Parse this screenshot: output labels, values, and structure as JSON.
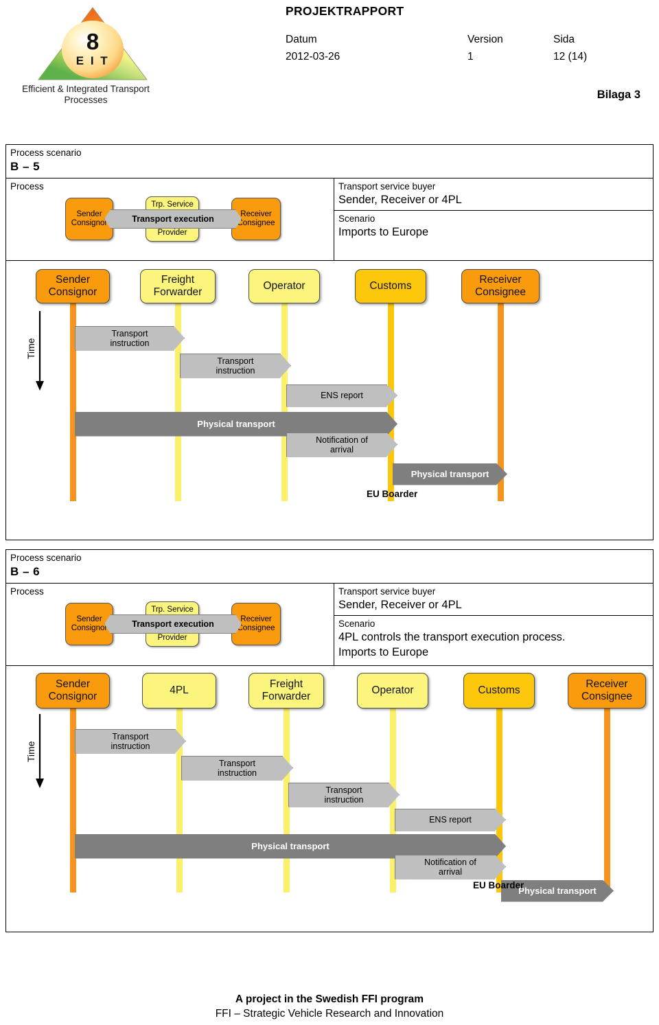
{
  "header": {
    "logo": {
      "number": "8",
      "acronym": "E I T",
      "caption": "Efficient & Integrated Transport Processes"
    },
    "title": "PROJEKTRAPPORT",
    "labels": {
      "datum": "Datum",
      "version": "Version",
      "sida": "Sida"
    },
    "values": {
      "datum": "2012-03-26",
      "version": "1",
      "sida": "12 (14)"
    },
    "appendix": "Bilaga 3"
  },
  "scenarios": [
    {
      "scenario_label": "Process scenario",
      "scenario_id": "B – 5",
      "process_label": "Process",
      "mini": {
        "sender": "Sender\nConsignor",
        "receiver": "Receiver\nConsignee",
        "provider_top": "Trp. Service",
        "provider_bottom": "Provider",
        "arrow": "Transport execution"
      },
      "buyer_label": "Transport service buyer",
      "buyer_value": "Sender, Receiver or 4PL",
      "scenario_desc_label": "Scenario",
      "scenario_desc_value": "Imports to Europe",
      "time_label": "Time",
      "eu_boarder": "EU Boarder",
      "lanes": [
        {
          "label": "Sender\nConsignor",
          "color": "c-orange",
          "line": "ll-orange"
        },
        {
          "label": "Freight\nForwarder",
          "color": "c-yellow",
          "line": "ll-yellow"
        },
        {
          "label": "Operator",
          "color": "c-yellow",
          "line": "ll-yellow"
        },
        {
          "label": "Customs",
          "color": "c-amber",
          "line": "ll-amber"
        },
        {
          "label": "Receiver\nConsignee",
          "color": "c-orange",
          "line": "ll-orange"
        }
      ],
      "messages": [
        {
          "text": "Transport\ninstruction",
          "from": 0,
          "to": 1,
          "style": "light"
        },
        {
          "text": "Transport\ninstruction",
          "from": 1,
          "to": 2,
          "style": "light"
        },
        {
          "text": "ENS report",
          "from": 2,
          "to": 3,
          "style": "light"
        },
        {
          "text": "Physical transport",
          "from": 0,
          "to": 3,
          "style": "dark"
        },
        {
          "text": "Notification of\narrival",
          "from": 2,
          "to": 3,
          "style": "light"
        },
        {
          "text": "Physical transport",
          "from": 3,
          "to": 4,
          "style": "dark"
        }
      ]
    },
    {
      "scenario_label": "Process scenario",
      "scenario_id": "B – 6",
      "process_label": "Process",
      "mini": {
        "sender": "Sender\nConsignor",
        "receiver": "Receiver\nConsignee",
        "provider_top": "Trp. Service",
        "provider_bottom": "Provider",
        "arrow": "Transport execution"
      },
      "buyer_label": "Transport service buyer",
      "buyer_value": "Sender, Receiver or 4PL",
      "scenario_desc_label": "Scenario",
      "scenario_desc_value": "4PL controls the transport execution process.\nImports to Europe",
      "time_label": "Time",
      "eu_boarder": "EU Boarder",
      "lanes": [
        {
          "label": "Sender\nConsignor",
          "color": "c-orange",
          "line": "ll-orange"
        },
        {
          "label": "4PL",
          "color": "c-yellow",
          "line": "ll-yellow"
        },
        {
          "label": "Freight\nForwarder",
          "color": "c-yellow",
          "line": "ll-yellow"
        },
        {
          "label": "Operator",
          "color": "c-yellow",
          "line": "ll-yellow"
        },
        {
          "label": "Customs",
          "color": "c-amber",
          "line": "ll-amber"
        },
        {
          "label": "Receiver\nConsignee",
          "color": "c-orange",
          "line": "ll-orange"
        }
      ],
      "messages": [
        {
          "text": "Transport\ninstruction",
          "from": 0,
          "to": 1,
          "style": "light"
        },
        {
          "text": "Transport\ninstruction",
          "from": 1,
          "to": 2,
          "style": "light"
        },
        {
          "text": "Transport\ninstruction",
          "from": 2,
          "to": 3,
          "style": "light"
        },
        {
          "text": "ENS report",
          "from": 3,
          "to": 4,
          "style": "light"
        },
        {
          "text": "Physical transport",
          "from": 0,
          "to": 4,
          "style": "dark"
        },
        {
          "text": "Notification of\narrival",
          "from": 3,
          "to": 4,
          "style": "light"
        },
        {
          "text": "Physical transport",
          "from": 4,
          "to": 5,
          "style": "dark"
        }
      ]
    }
  ],
  "footer": {
    "line1": "A project in the Swedish FFI program",
    "line2": "FFI – Strategic Vehicle Research and Innovation"
  },
  "colors": {
    "orange": "#F99B0C",
    "lifeline_orange": "#F7941E",
    "yellow": "#FBF57D",
    "amber": "#FDC70B",
    "msg_light": "#BFBFBF",
    "msg_dark": "#7F7F7F"
  }
}
